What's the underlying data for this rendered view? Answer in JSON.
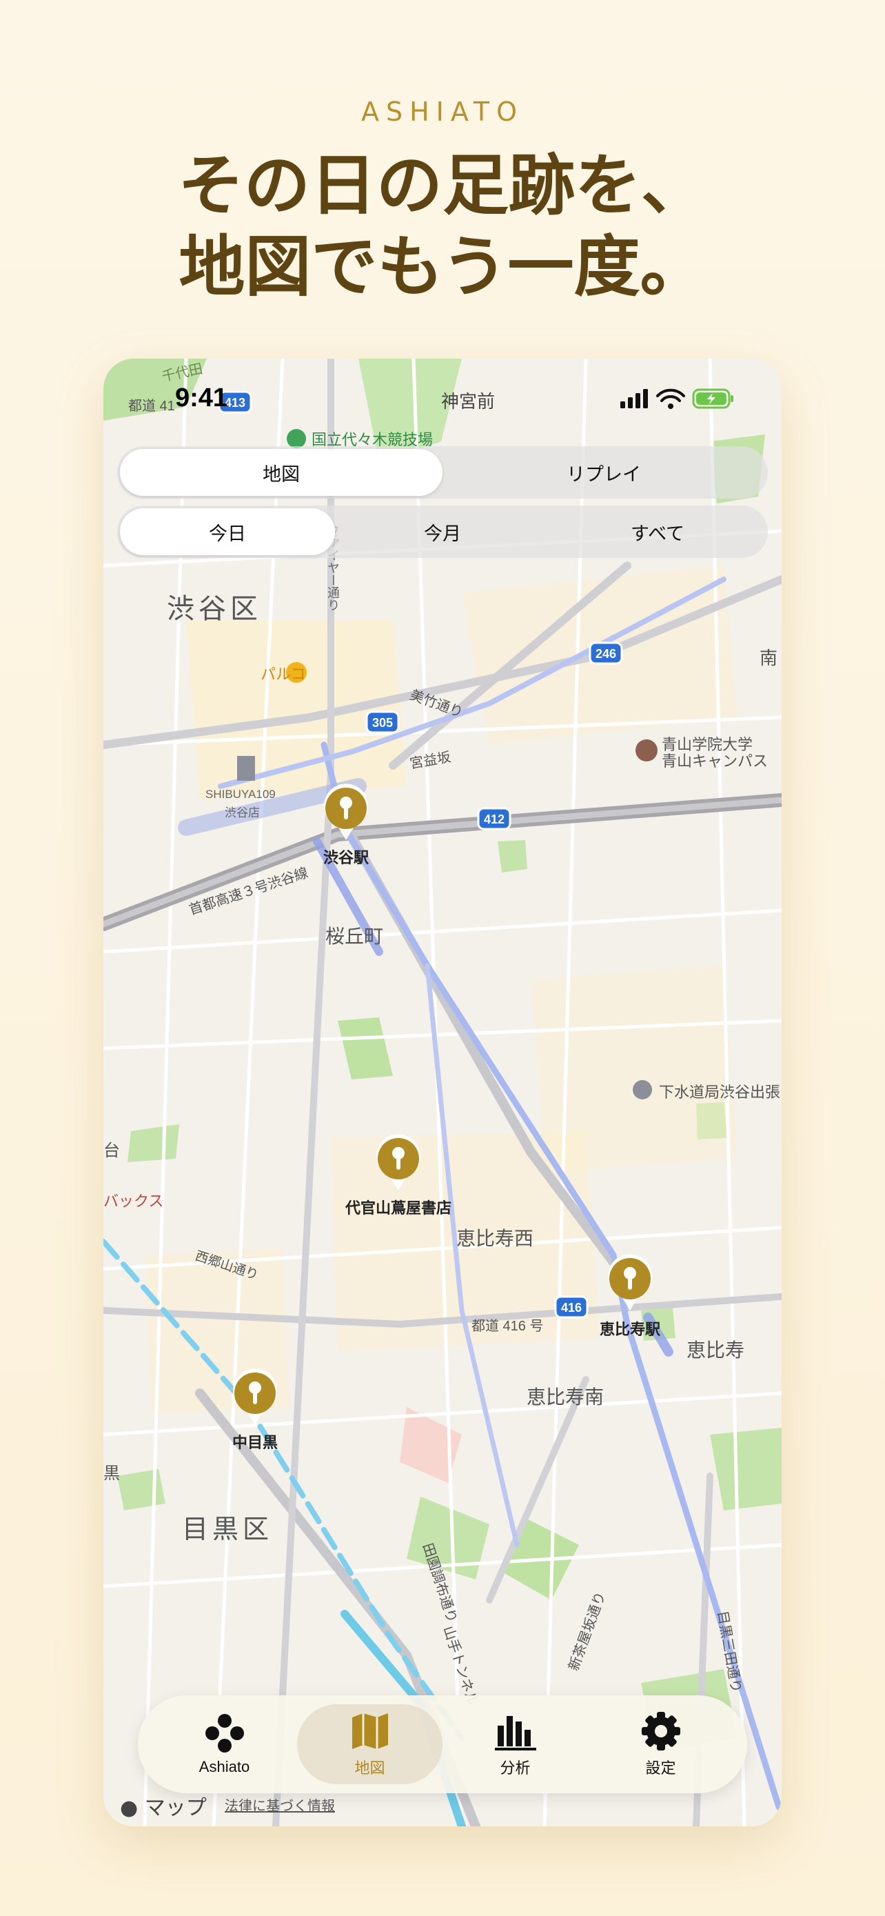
{
  "brand": "ASHIATO",
  "headline": {
    "line1": "その日の足跡を、",
    "line2": "地図でもう一度。"
  },
  "status": {
    "time": "9:41"
  },
  "view_segment": {
    "options": [
      "地図",
      "リプレイ"
    ],
    "selected": "地図"
  },
  "range_segment": {
    "options": [
      "今日",
      "今月",
      "すべて"
    ],
    "selected": "今日"
  },
  "map": {
    "labels": {
      "jingumae": "神宮前",
      "stadium": "国立代々木競技場",
      "shibuya_ward": "渋谷区",
      "parco": "パルコ",
      "shibuya109_a": "SHIBUYA109",
      "shibuya109_b": "渋谷店",
      "mitake": "美竹通り",
      "miyamasuzaka": "宮益坂",
      "fire_st": "ファイヤー通り",
      "aoyama_a": "青山学院大学",
      "aoyama_b": "青山キャンパス",
      "minami": "南",
      "expressway": "首都高速３号渋谷線",
      "sakuragaoka": "桜丘町",
      "sewer": "下水道局渋谷出張",
      "dai": "台",
      "backs": "バックス",
      "ebisu_nishi": "恵比寿西",
      "saigoyama": "西郷山通り",
      "route416": "都道 416 号",
      "ebisu": "恵比寿",
      "ebisu_minami": "恵比寿南",
      "kuro": "黒",
      "meguro_ward": "目黒区",
      "denen": "田園調布通り",
      "yamate": "山手トンネル",
      "shinkokaido": "新茶屋坂通り",
      "meguro_mita": "目黒三田通り",
      "route41x": "都道 41",
      "sendagaya": "千代田"
    },
    "shields": [
      "413",
      "305",
      "246",
      "412",
      "416"
    ],
    "pins": [
      {
        "name": "渋谷駅"
      },
      {
        "name": "代官山蔦屋書店"
      },
      {
        "name": "恵比寿駅"
      },
      {
        "name": "中目黒"
      }
    ],
    "pin_color": "#b08a22",
    "attribution": "マップ",
    "legal": "法律に基づく情報"
  },
  "tabbar": {
    "tabs": [
      {
        "label": "Ashiato",
        "icon": "footprints-icon"
      },
      {
        "label": "地図",
        "icon": "map-icon"
      },
      {
        "label": "分析",
        "icon": "bar-chart-icon"
      },
      {
        "label": "設定",
        "icon": "gear-icon"
      }
    ],
    "selected": "地図",
    "accent": "#b0891f"
  }
}
